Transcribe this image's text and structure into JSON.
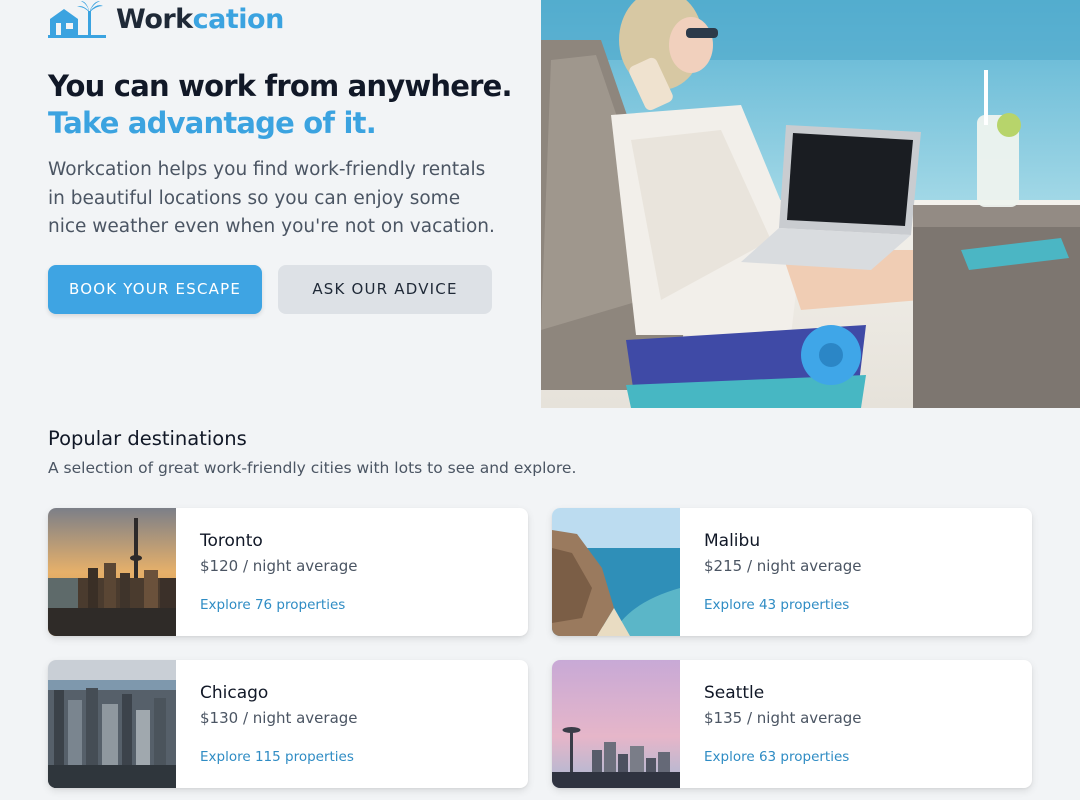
{
  "brand": {
    "name_part1": "Work",
    "name_part2": "cation",
    "accent_color": "#3ba3e0"
  },
  "hero": {
    "headline_line1": "You can work from anywhere.",
    "headline_line2": "Take advantage of it.",
    "description": "Workcation helps you find work-friendly rentals in beautiful locations so you can enjoy some nice weather even when you're not on vacation.",
    "primary_button": "BOOK YOUR ESCAPE",
    "secondary_button": "ASK OUR ADVICE",
    "image_icon": "beach-laptop-photo"
  },
  "destinations": {
    "title": "Popular destinations",
    "subtitle": "A selection of great work-friendly cities with lots to see and explore.",
    "items": [
      {
        "city": "Toronto",
        "price": "$120 / night average",
        "link": "Explore 76 properties",
        "image": "toronto-skyline"
      },
      {
        "city": "Malibu",
        "price": "$215 / night average",
        "link": "Explore 43 properties",
        "image": "malibu-coast"
      },
      {
        "city": "Chicago",
        "price": "$130 / night average",
        "link": "Explore 115 properties",
        "image": "chicago-skyline"
      },
      {
        "city": "Seattle",
        "price": "$135 / night average",
        "link": "Explore 63 properties",
        "image": "seattle-skyline"
      }
    ]
  }
}
